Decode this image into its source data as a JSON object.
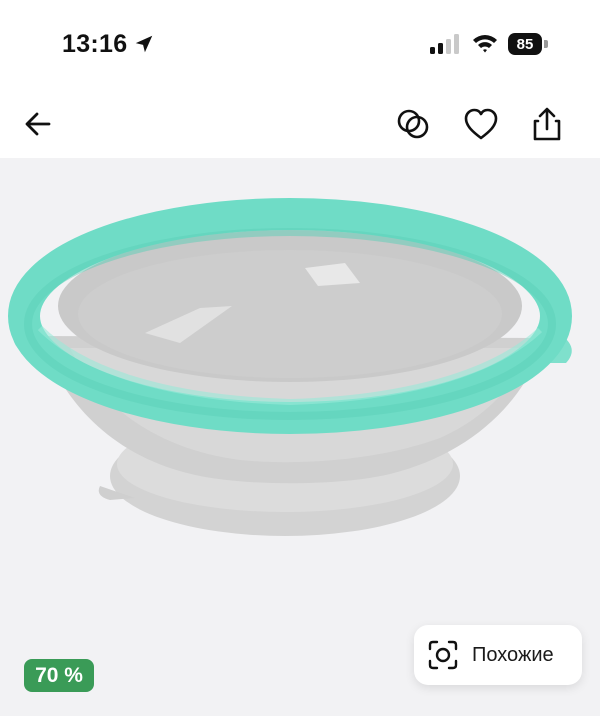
{
  "status_bar": {
    "time": "13:16",
    "battery_percent": "85",
    "icons": [
      "location-arrow-icon",
      "signal-icon",
      "wifi-icon",
      "battery-icon"
    ]
  },
  "nav": {
    "icons": [
      "back-arrow-icon",
      "compare-icon",
      "heart-icon",
      "share-icon"
    ]
  },
  "product": {
    "image": "teal-rim-baby-bowl-with-suction-base",
    "discount_badge": "70 %",
    "similar_button_label": "Похожие",
    "similar_icon": "visual-search-icon"
  },
  "colors": {
    "background": "#ffffff",
    "image_background": "#f2f2f4",
    "rim": "#6fdcc6",
    "bowl": "#d6d6d6",
    "badge": "#3a9b57"
  }
}
